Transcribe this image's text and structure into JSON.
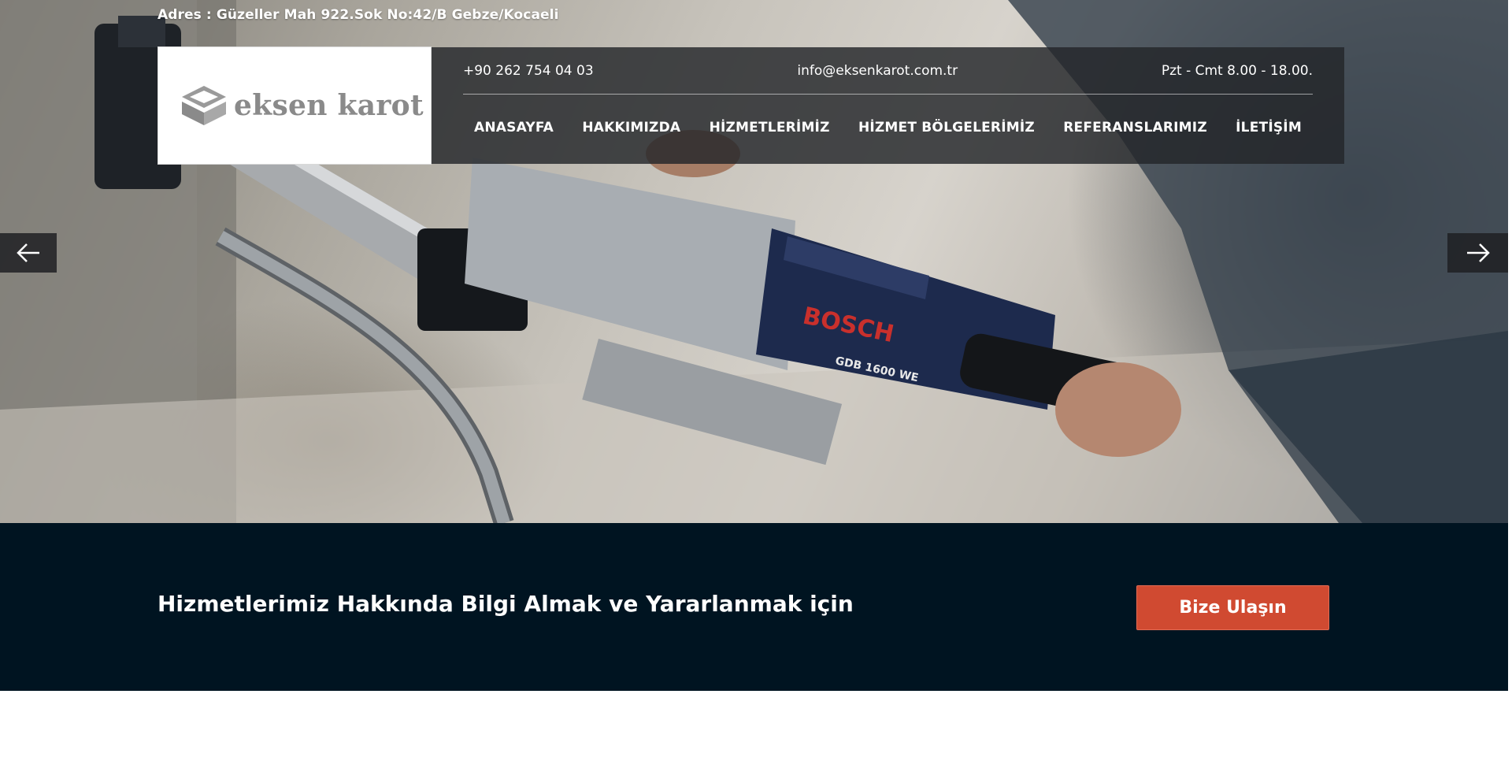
{
  "top": {
    "address_label": "Adres :",
    "address_value": "Güzeller Mah 922.Sok No:42/B Gebze/Kocaeli"
  },
  "logo": {
    "text": "eksen karot",
    "icon": "cube-logo-icon"
  },
  "contact": {
    "phone": "+90 262 754 04 03",
    "email": "info@eksenkarot.com.tr",
    "hours": "Pzt - Cmt 8.00 - 18.00."
  },
  "nav": {
    "items": [
      {
        "label": "ANASAYFA"
      },
      {
        "label": "HAKKIMIZDA"
      },
      {
        "label": "HİZMETLERİMİZ"
      },
      {
        "label": "HİZMET BÖLGELERİMİZ"
      },
      {
        "label": "REFERANSLARIMIZ"
      },
      {
        "label": "İLETİŞİM"
      }
    ]
  },
  "slider": {
    "prev_icon": "arrow-left-icon",
    "next_icon": "arrow-right-icon",
    "image_brand": "BOSCH",
    "image_model": "GDB 1600 WE"
  },
  "cta": {
    "text": "Hizmetlerimiz Hakkında Bilgi Almak ve Yararlanmak için",
    "button_label": "Bize Ulaşın"
  },
  "colors": {
    "cta_band": "#001421",
    "cta_button": "#d04a31",
    "header_overlay": "#232629"
  }
}
